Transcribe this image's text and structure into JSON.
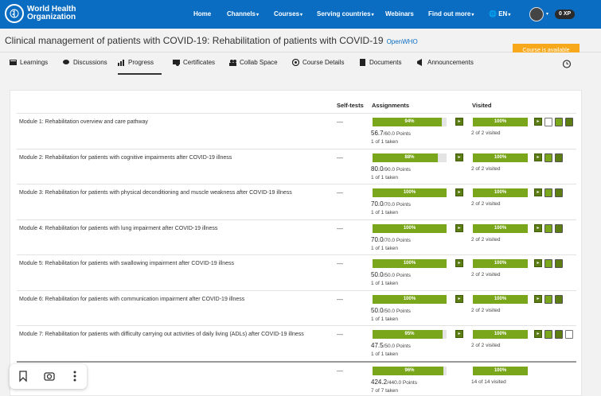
{
  "header": {
    "logo_line1": "World Health",
    "logo_line2": "Organization",
    "nav": [
      "Home",
      "Channels",
      "Courses",
      "Serving countries",
      "Webinars",
      "Find out more"
    ],
    "language": "EN",
    "xp": "0 XP"
  },
  "course": {
    "title": "Clinical management of patients with COVID-19: Rehabilitation of patients with COVID-19",
    "tag": "OpenWHO",
    "status_badge": "Course is available"
  },
  "tabs": [
    "Learnings",
    "Discussions",
    "Progress",
    "Certificates",
    "Collab Space",
    "Course Details",
    "Documents",
    "Announcements"
  ],
  "active_tab": "Progress",
  "table": {
    "headers": {
      "selftests": "Self-tests",
      "assignments": "Assignments",
      "visited": "Visited"
    },
    "rows": [
      {
        "title": "Module 1: Rehabilitation overview and care pathway",
        "selftests": "—",
        "assign_pct": 0.94,
        "assign_label": "94%",
        "points": "56.7",
        "points_total": "/60.0 Points",
        "taken": "1 of 1 taken",
        "visited_pct": 1.0,
        "visited_label": "100%",
        "visited_text": "2 of 2 visited",
        "icons": [
          "document-icon",
          "video-icon",
          "forward-icon"
        ]
      },
      {
        "title": "Module 2: Rehabilitation for patients with cognitive impairments after COVID-19 illness",
        "selftests": "—",
        "assign_pct": 0.88,
        "assign_label": "88%",
        "points": "80.0",
        "points_total": "/90.0 Points",
        "taken": "1 of 1 taken",
        "visited_pct": 1.0,
        "visited_label": "100%",
        "visited_text": "2 of 2 visited",
        "icons": [
          "video-icon",
          "forward-icon"
        ]
      },
      {
        "title": "Module 3: Rehabilitation for patients with physical deconditioning and muscle weakness after COVID-19 illness",
        "selftests": "—",
        "assign_pct": 1.0,
        "assign_label": "100%",
        "points": "70.0",
        "points_total": "/70.0 Points",
        "taken": "1 of 1 taken",
        "visited_pct": 1.0,
        "visited_label": "100%",
        "visited_text": "2 of 2 visited",
        "icons": [
          "video-icon",
          "forward-icon"
        ]
      },
      {
        "title": "Module 4: Rehabilitation for patients with lung impairment after COVID-19 illness",
        "selftests": "—",
        "assign_pct": 1.0,
        "assign_label": "100%",
        "points": "70.0",
        "points_total": "/70.0 Points",
        "taken": "1 of 1 taken",
        "visited_pct": 1.0,
        "visited_label": "100%",
        "visited_text": "2 of 2 visited",
        "icons": [
          "video-icon",
          "forward-icon"
        ]
      },
      {
        "title": "Module 5: Rehabilitation for patients with swallowing impairment after COVID-19 illness",
        "selftests": "—",
        "assign_pct": 1.0,
        "assign_label": "100%",
        "points": "50.0",
        "points_total": "/50.0 Points",
        "taken": "1 of 1 taken",
        "visited_pct": 1.0,
        "visited_label": "100%",
        "visited_text": "2 of 2 visited",
        "icons": [
          "video-icon",
          "forward-icon"
        ]
      },
      {
        "title": "Module 6: Rehabilitation for patients with communication impairment after COVID-19 illness",
        "selftests": "—",
        "assign_pct": 1.0,
        "assign_label": "100%",
        "points": "50.0",
        "points_total": "/50.0 Points",
        "taken": "1 of 1 taken",
        "visited_pct": 1.0,
        "visited_label": "100%",
        "visited_text": "2 of 2 visited",
        "icons": [
          "video-icon",
          "forward-icon"
        ]
      },
      {
        "title": "Module 7: Rehabilitation for patients with difficulty carrying out activities of daily living (ADLs) after COVID-19 illness",
        "selftests": "—",
        "assign_pct": 0.95,
        "assign_label": "95%",
        "points": "47.5",
        "points_total": "/50.0 Points",
        "taken": "1 of 1 taken",
        "visited_pct": 1.0,
        "visited_label": "100%",
        "visited_text": "2 of 2 visited",
        "icons": [
          "video-icon",
          "forward-icon",
          "document-icon"
        ]
      }
    ],
    "total": {
      "selftests": "—",
      "assign_pct": 0.96,
      "assign_label": "96%",
      "points": "424.2",
      "points_total": "/440.0 Points",
      "taken": "7 of 7 taken",
      "visited_pct": 1.0,
      "visited_label": "100%",
      "visited_text": "14 of 14 visited"
    }
  },
  "colors": {
    "header": "#0a6dc2",
    "bar": "#7aa61b",
    "badge": "#f7a81b"
  },
  "floatbar": [
    "bookmark-icon",
    "camera-icon",
    "more-icon"
  ]
}
